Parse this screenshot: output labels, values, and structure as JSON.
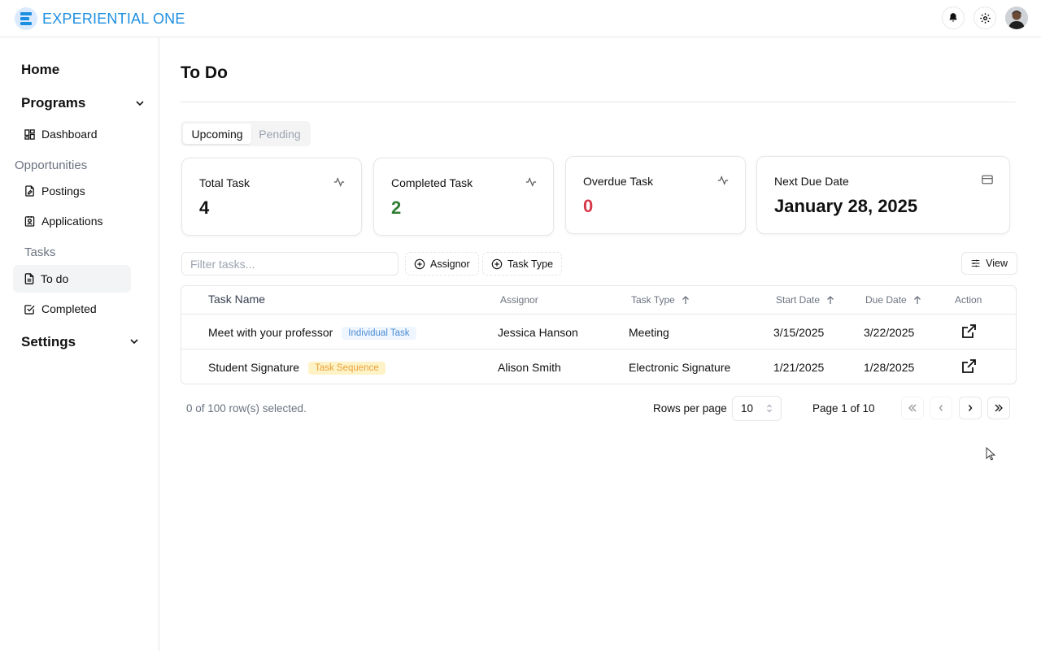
{
  "brand": {
    "name": "EXPERIENTIAL ONE"
  },
  "sidebar": {
    "home": "Home",
    "programs": "Programs",
    "dashboard": "Dashboard",
    "opportunities": "Opportunities",
    "postings": "Postings",
    "applications": "Applications",
    "tasks": "Tasks",
    "todo": "To do",
    "completed": "Completed",
    "settings": "Settings"
  },
  "page": {
    "title": "To Do"
  },
  "tabs": [
    {
      "label": "Upcoming",
      "selected": true
    },
    {
      "label": "Pending",
      "selected": false
    }
  ],
  "stats": [
    {
      "label": "Total Task",
      "value": "4",
      "color": "#111111",
      "icon": "activity-icon"
    },
    {
      "label": "Completed Task",
      "value": "2",
      "color": "#2e7d32",
      "icon": "activity-icon"
    },
    {
      "label": "Overdue Task",
      "value": "0",
      "color": "#d63a4a",
      "icon": "activity-icon"
    },
    {
      "label": "Next Due Date",
      "value": "January 28, 2025",
      "color": "#111111",
      "icon": "credit-card-icon"
    }
  ],
  "toolbar": {
    "filter_placeholder": "Filter tasks...",
    "assignor_label": "Assignor",
    "task_type_label": "Task Type",
    "view_label": "View"
  },
  "table": {
    "headers": {
      "task_name": "Task Name",
      "assignor": "Assignor",
      "task_type": "Task Type",
      "start_date": "Start Date",
      "due_date": "Due Date",
      "action": "Action"
    },
    "rows": [
      {
        "task_name": "Meet with your professor",
        "badge": "Individual Task",
        "badge_color": "#4b8bd0",
        "assignor": "Jessica Hanson",
        "task_type": "Meeting",
        "start_date": "3/15/2025",
        "due_date": "3/22/2025"
      },
      {
        "task_name": "Student Signature",
        "badge": "Task Sequence",
        "badge_color": "#e8a23b",
        "assignor": "Alison Smith",
        "task_type": "Electronic Signature",
        "start_date": "1/21/2025",
        "due_date": "1/28/2025"
      }
    ]
  },
  "pagination": {
    "selected_text": "0 of 100 row(s) selected.",
    "rows_per_page_label": "Rows per page",
    "rows_per_page_value": "10",
    "page_text": "Page 1 of 10"
  },
  "colors": {
    "brand": "#1d8fe1",
    "border": "#e5e7eb",
    "muted": "#6b7280"
  }
}
